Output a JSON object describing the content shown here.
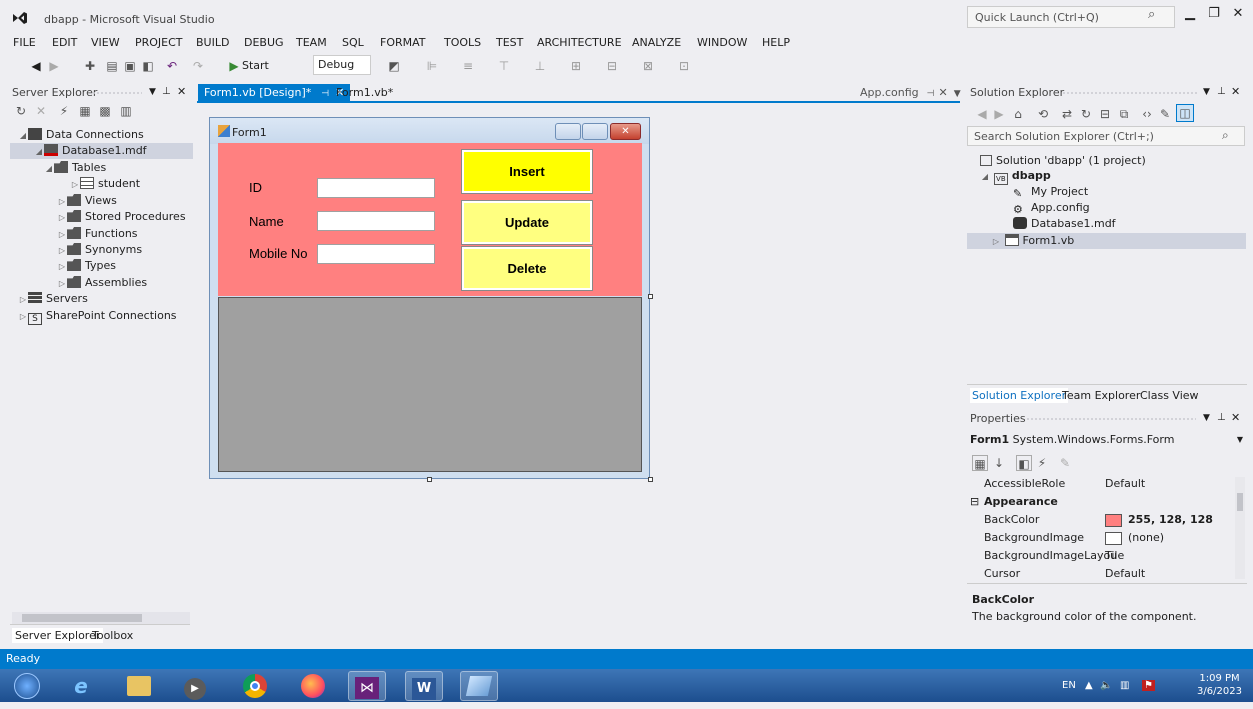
{
  "app": {
    "title": "dbapp - Microsoft Visual Studio",
    "quick_launch_placeholder": "Quick Launch (Ctrl+Q)"
  },
  "menu": [
    "FILE",
    "EDIT",
    "VIEW",
    "PROJECT",
    "BUILD",
    "DEBUG",
    "TEAM",
    "SQL",
    "FORMAT",
    "TOOLS",
    "TEST",
    "ARCHITECTURE",
    "ANALYZE",
    "WINDOW",
    "HELP"
  ],
  "toolbar": {
    "start_label": "Start",
    "config_value": "Debug"
  },
  "server_explorer": {
    "title": "Server Explorer",
    "items": [
      {
        "label": "Data Connections"
      },
      {
        "label": "Database1.mdf"
      },
      {
        "label": "Tables"
      },
      {
        "label": "student"
      },
      {
        "label": "Views"
      },
      {
        "label": "Stored Procedures"
      },
      {
        "label": "Functions"
      },
      {
        "label": "Synonyms"
      },
      {
        "label": "Types"
      },
      {
        "label": "Assemblies"
      },
      {
        "label": "Servers"
      },
      {
        "label": "SharePoint Connections"
      }
    ],
    "bottom_tabs": [
      "Server Explorer",
      "Toolbox"
    ]
  },
  "tabs": {
    "active": "Form1.vb [Design]*",
    "second": "Form1.vb*",
    "right": "App.config"
  },
  "form": {
    "title": "Form1",
    "labels": {
      "id": "ID",
      "name": "Name",
      "mobile": "Mobile No"
    },
    "buttons": {
      "insert": "Insert",
      "update": "Update",
      "delete": "Delete"
    }
  },
  "solution_explorer": {
    "title": "Solution Explorer",
    "search_placeholder": "Search Solution Explorer (Ctrl+;)",
    "items": [
      {
        "label": "Solution 'dbapp' (1 project)"
      },
      {
        "label": "dbapp"
      },
      {
        "label": "My Project"
      },
      {
        "label": "App.config"
      },
      {
        "label": "Database1.mdf"
      },
      {
        "label": "Form1.vb"
      }
    ],
    "bottom_tabs": [
      "Solution Explorer",
      "Team Explorer",
      "Class View"
    ]
  },
  "properties": {
    "title": "Properties",
    "object_name": "Form1",
    "object_type": "System.Windows.Forms.Form",
    "rows": [
      {
        "name": "AccessibleRole",
        "value": "Default"
      },
      {
        "name": "Appearance",
        "value": ""
      },
      {
        "name": "BackColor",
        "value": "255, 128, 128"
      },
      {
        "name": "BackgroundImage",
        "value": "(none)"
      },
      {
        "name": "BackgroundImageLayou",
        "value": "Tile"
      },
      {
        "name": "Cursor",
        "value": "Default"
      }
    ],
    "desc_title": "BackColor",
    "desc_text": "The background color of the component."
  },
  "status": {
    "text": "Ready"
  },
  "taskbar": {
    "lang": "EN",
    "time": "1:09 PM",
    "date": "3/6/2023"
  },
  "colors": {
    "accent": "#007acc",
    "form_back": "#ff8080",
    "button_yellow": "#ffff00"
  }
}
